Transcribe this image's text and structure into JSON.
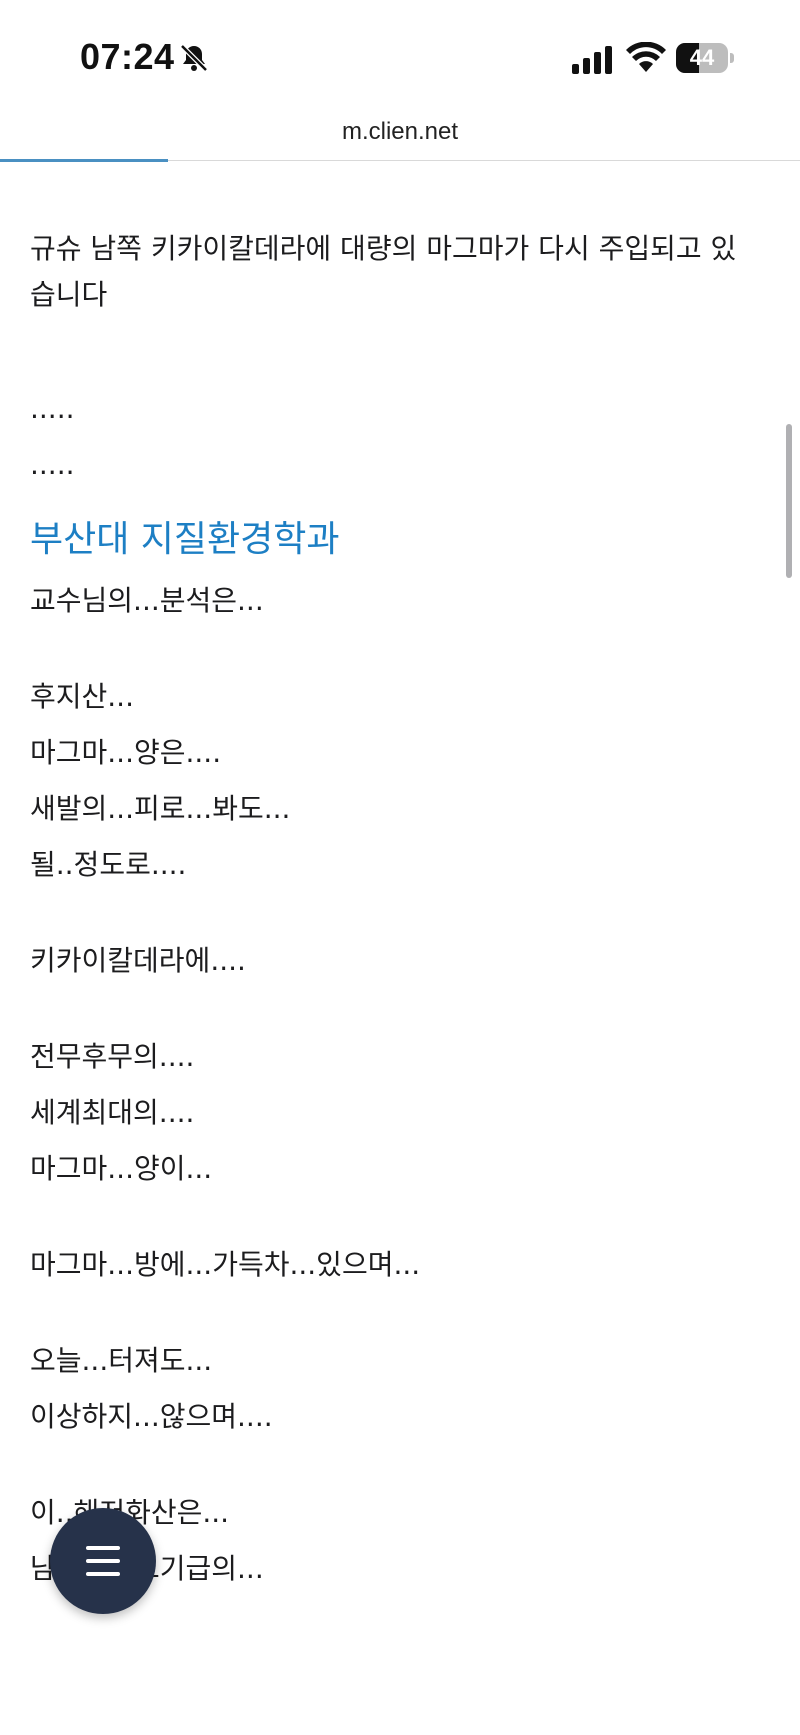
{
  "status_bar": {
    "time": "07:24",
    "battery_level": "44",
    "battery_fraction": 0.44,
    "icons": [
      "bell-slash-icon",
      "cellular-signal-icon",
      "wifi-icon",
      "battery-icon"
    ]
  },
  "browser": {
    "url": "m.clien.net",
    "load_progress_fraction": 0.21
  },
  "article": {
    "intro_line1": "규슈 남쪽 키카이칼데라에 대량의 마그마가 다시 주입되고 있",
    "intro_line2": "습니다",
    "dots1": ".....",
    "dots2": ".....",
    "heading": "부산대 지질환경학과",
    "line_professor": "교수님의...분석은...",
    "line_fuji": "후지산...",
    "line_magma_amount": "마그마...양은....",
    "line_eruption_fatigue": "새발의...피로...봐도...",
    "line_degree": "될..정도로....",
    "line_kikai": "키카이칼데라에....",
    "line_unprecedented": "전무후무의....",
    "line_world_largest": "세계최대의....",
    "line_magma_amount2": "마그마...양이...",
    "line_chamber_full": "마그마...방에...가득차...있으며...",
    "line_today": "오늘...터져도...",
    "line_not_strange": "이상하지...않으며....",
    "line_submarine": "이..해저화산은...",
    "line_partial": "남한의...크기급의..."
  },
  "fab": {
    "icon": "menu-icon",
    "color": "#26324a"
  },
  "colors": {
    "heading": "#1d7fc4",
    "progress": "#4a90c2"
  }
}
